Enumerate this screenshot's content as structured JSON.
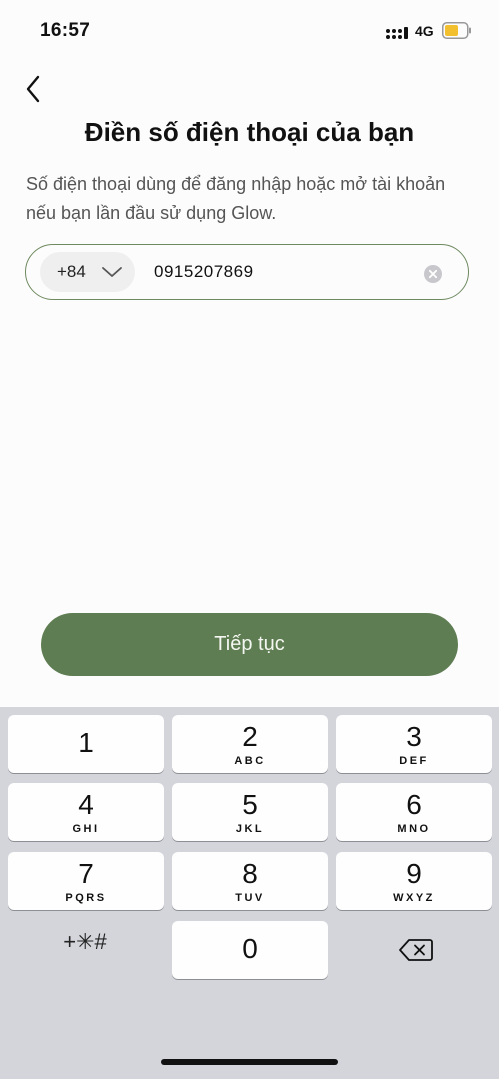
{
  "status_bar": {
    "time": "16:57",
    "network": "4G",
    "battery_color": "#f2c02e"
  },
  "header": {
    "title": "Điền số điện thoại của bạn",
    "subtitle": "Số điện thoại dùng để đăng nhập hoặc mở tài khoản nếu bạn lần đầu sử dụng Glow."
  },
  "phone_field": {
    "country_code": "+84",
    "value": "0915207869",
    "border_color": "#6e8a5f"
  },
  "continue_button": {
    "label": "Tiếp tục",
    "color": "#5f7d52"
  },
  "keyboard": {
    "keys": [
      {
        "digit": "1",
        "letters": ""
      },
      {
        "digit": "2",
        "letters": "ABC"
      },
      {
        "digit": "3",
        "letters": "DEF"
      },
      {
        "digit": "4",
        "letters": "GHI"
      },
      {
        "digit": "5",
        "letters": "JKL"
      },
      {
        "digit": "6",
        "letters": "MNO"
      },
      {
        "digit": "7",
        "letters": "PQRS"
      },
      {
        "digit": "8",
        "letters": "TUV"
      },
      {
        "digit": "9",
        "letters": "WXYZ"
      },
      {
        "digit": "0",
        "letters": ""
      }
    ],
    "symbols_label": "+✳#",
    "delete_icon": "backspace-icon"
  }
}
